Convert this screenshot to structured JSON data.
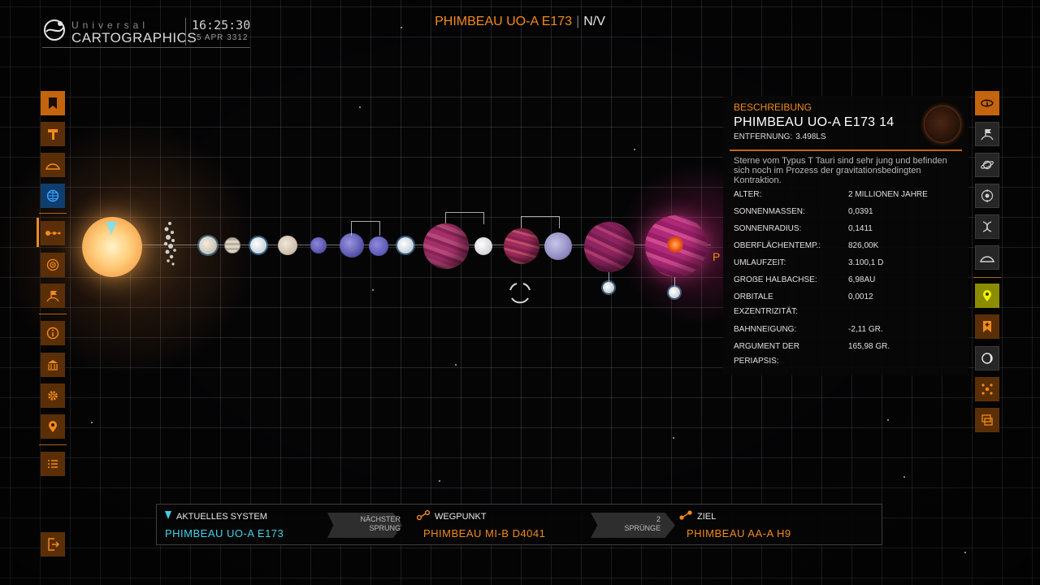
{
  "header": {
    "logo_line1": "Universal",
    "logo_line2": "CARTOGRAPHICS",
    "time": "16:25:30",
    "date": "5 APR 3312",
    "system_name": "PHIMBEAU UO-A E173",
    "separator": "|",
    "allegiance": "N/V"
  },
  "left_sidebar": [
    {
      "name": "bookmark-icon",
      "glyph": "🔖"
    },
    {
      "name": "hammer-icon",
      "glyph": "⚒"
    },
    {
      "name": "terrain-icon",
      "glyph": "⛰"
    },
    {
      "name": "globe-icon",
      "glyph": "🌐"
    },
    {
      "name": "system-map-icon",
      "glyph": "⊶"
    },
    {
      "name": "orbit-icon",
      "glyph": "◎"
    },
    {
      "name": "planet-flag-icon",
      "glyph": "⚑"
    },
    {
      "name": "info-icon",
      "glyph": "ⓘ"
    },
    {
      "name": "government-icon",
      "glyph": "🏛"
    },
    {
      "name": "settings-icon",
      "glyph": "⚙"
    },
    {
      "name": "location-pin-icon",
      "glyph": "⚲"
    },
    {
      "name": "list-icon",
      "glyph": "☰"
    }
  ],
  "left_sidebar_zero_badges": [
    "0",
    "0"
  ],
  "right_sidebar": [
    {
      "name": "info-icon",
      "glyph": "ⓘ"
    },
    {
      "name": "planet-flag-icon",
      "glyph": "⚑"
    },
    {
      "name": "ring-planet-icon",
      "glyph": "🪐"
    },
    {
      "name": "star-target-icon",
      "glyph": "◉"
    },
    {
      "name": "dna-icon",
      "glyph": "⧖"
    },
    {
      "name": "terrain-icon",
      "glyph": "⛰"
    },
    {
      "name": "pin-icon",
      "glyph": "⚲"
    },
    {
      "name": "add-bookmark-icon",
      "glyph": "🔖"
    },
    {
      "name": "moon-icon",
      "glyph": "☾"
    },
    {
      "name": "network-icon",
      "glyph": "⁘"
    },
    {
      "name": "screen-icon",
      "glyph": "⧉"
    }
  ],
  "right_sidebar_zero_badge": "0",
  "orrery": {
    "partial_label": "P"
  },
  "info_panel": {
    "heading": "BESCHREIBUNG",
    "body_name": "PHIMBEAU UO-A E173 14",
    "distance_label": "ENTFERNUNG:",
    "distance_value": "3.498LS",
    "description": "Sterne vom Typus T Tauri sind sehr jung und befinden sich noch im Prozess der gravitationsbedingten Kontraktion.",
    "rows": [
      {
        "key": "ALTER:",
        "value": "2 MILLIONEN JAHRE"
      },
      {
        "key": "SONNENMASSEN:",
        "value": "0,0391"
      },
      {
        "key": "SONNENRADIUS:",
        "value": "0,1411"
      },
      {
        "key": "OBERFLÄCHENTEMP.:",
        "value": "826,00K"
      },
      {
        "key": "UMLAUFZEIT:",
        "value": "3.100,1 D"
      },
      {
        "key": "GROẞE HALBACHSE:",
        "value": "6,98AU"
      },
      {
        "key": "ORBITALE EXZENTRIZITÄT:",
        "value": "0,0012"
      },
      {
        "key": "BAHNNEIGUNG:",
        "value": "-2,11 GR."
      },
      {
        "key": "ARGUMENT DER PERIAPSIS:",
        "value": "165,98 GR."
      }
    ]
  },
  "route": {
    "current_label": "AKTUELLES SYSTEM",
    "current_value": "PHIMBEAU UO-A E173",
    "next_jump_line1": "NÄCHSTER",
    "next_jump_line2": "SPRUNG",
    "waypoint_label": "WEGPUNKT",
    "waypoint_value": "PHIMBEAU MI-B D4041",
    "jumps_count": "2",
    "jumps_label": "SPRÜNGE",
    "destination_label": "ZIEL",
    "destination_value": "PHIMBEAU AA-A H9"
  },
  "colors": {
    "accent_orange": "#f28a1c",
    "current_system_cyan": "#44d0e8",
    "panel_bg": "#080808"
  },
  "exit_icon": "exit-icon"
}
